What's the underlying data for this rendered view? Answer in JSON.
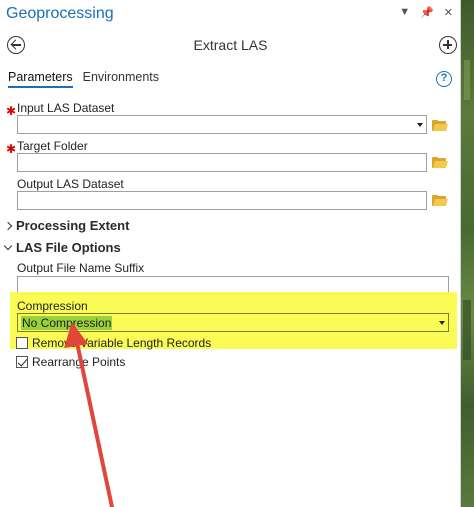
{
  "pane": {
    "title": "Geoprocessing",
    "tool_title": "Extract LAS",
    "icons": [
      "dropdown-icon",
      "pin-icon",
      "close-icon"
    ]
  },
  "tabs": [
    {
      "label": "Parameters",
      "active": true
    },
    {
      "label": "Environments",
      "active": false
    }
  ],
  "params": {
    "input_las": {
      "label": "Input LAS Dataset",
      "value": "",
      "required": true
    },
    "target_folder": {
      "label": "Target Folder",
      "value": "",
      "required": true
    },
    "output_las": {
      "label": "Output LAS Dataset",
      "value": ""
    }
  },
  "sections": {
    "processing_extent": {
      "label": "Processing Extent",
      "expanded": false
    },
    "las_file_options": {
      "label": "LAS File Options",
      "expanded": true
    }
  },
  "las_options": {
    "suffix": {
      "label": "Output File Name Suffix",
      "value": ""
    },
    "compression": {
      "label": "Compression",
      "value": "No Compression"
    },
    "remove_vlr": {
      "label": "Remove Variable Length Records",
      "checked": false
    },
    "rearrange": {
      "label": "Rearrange Points",
      "checked": true
    }
  },
  "colors": {
    "accent": "#1a6fb8",
    "required": "#dd0000",
    "highlight": "#fbfb48",
    "annotation_arrow": "#e0463a"
  }
}
